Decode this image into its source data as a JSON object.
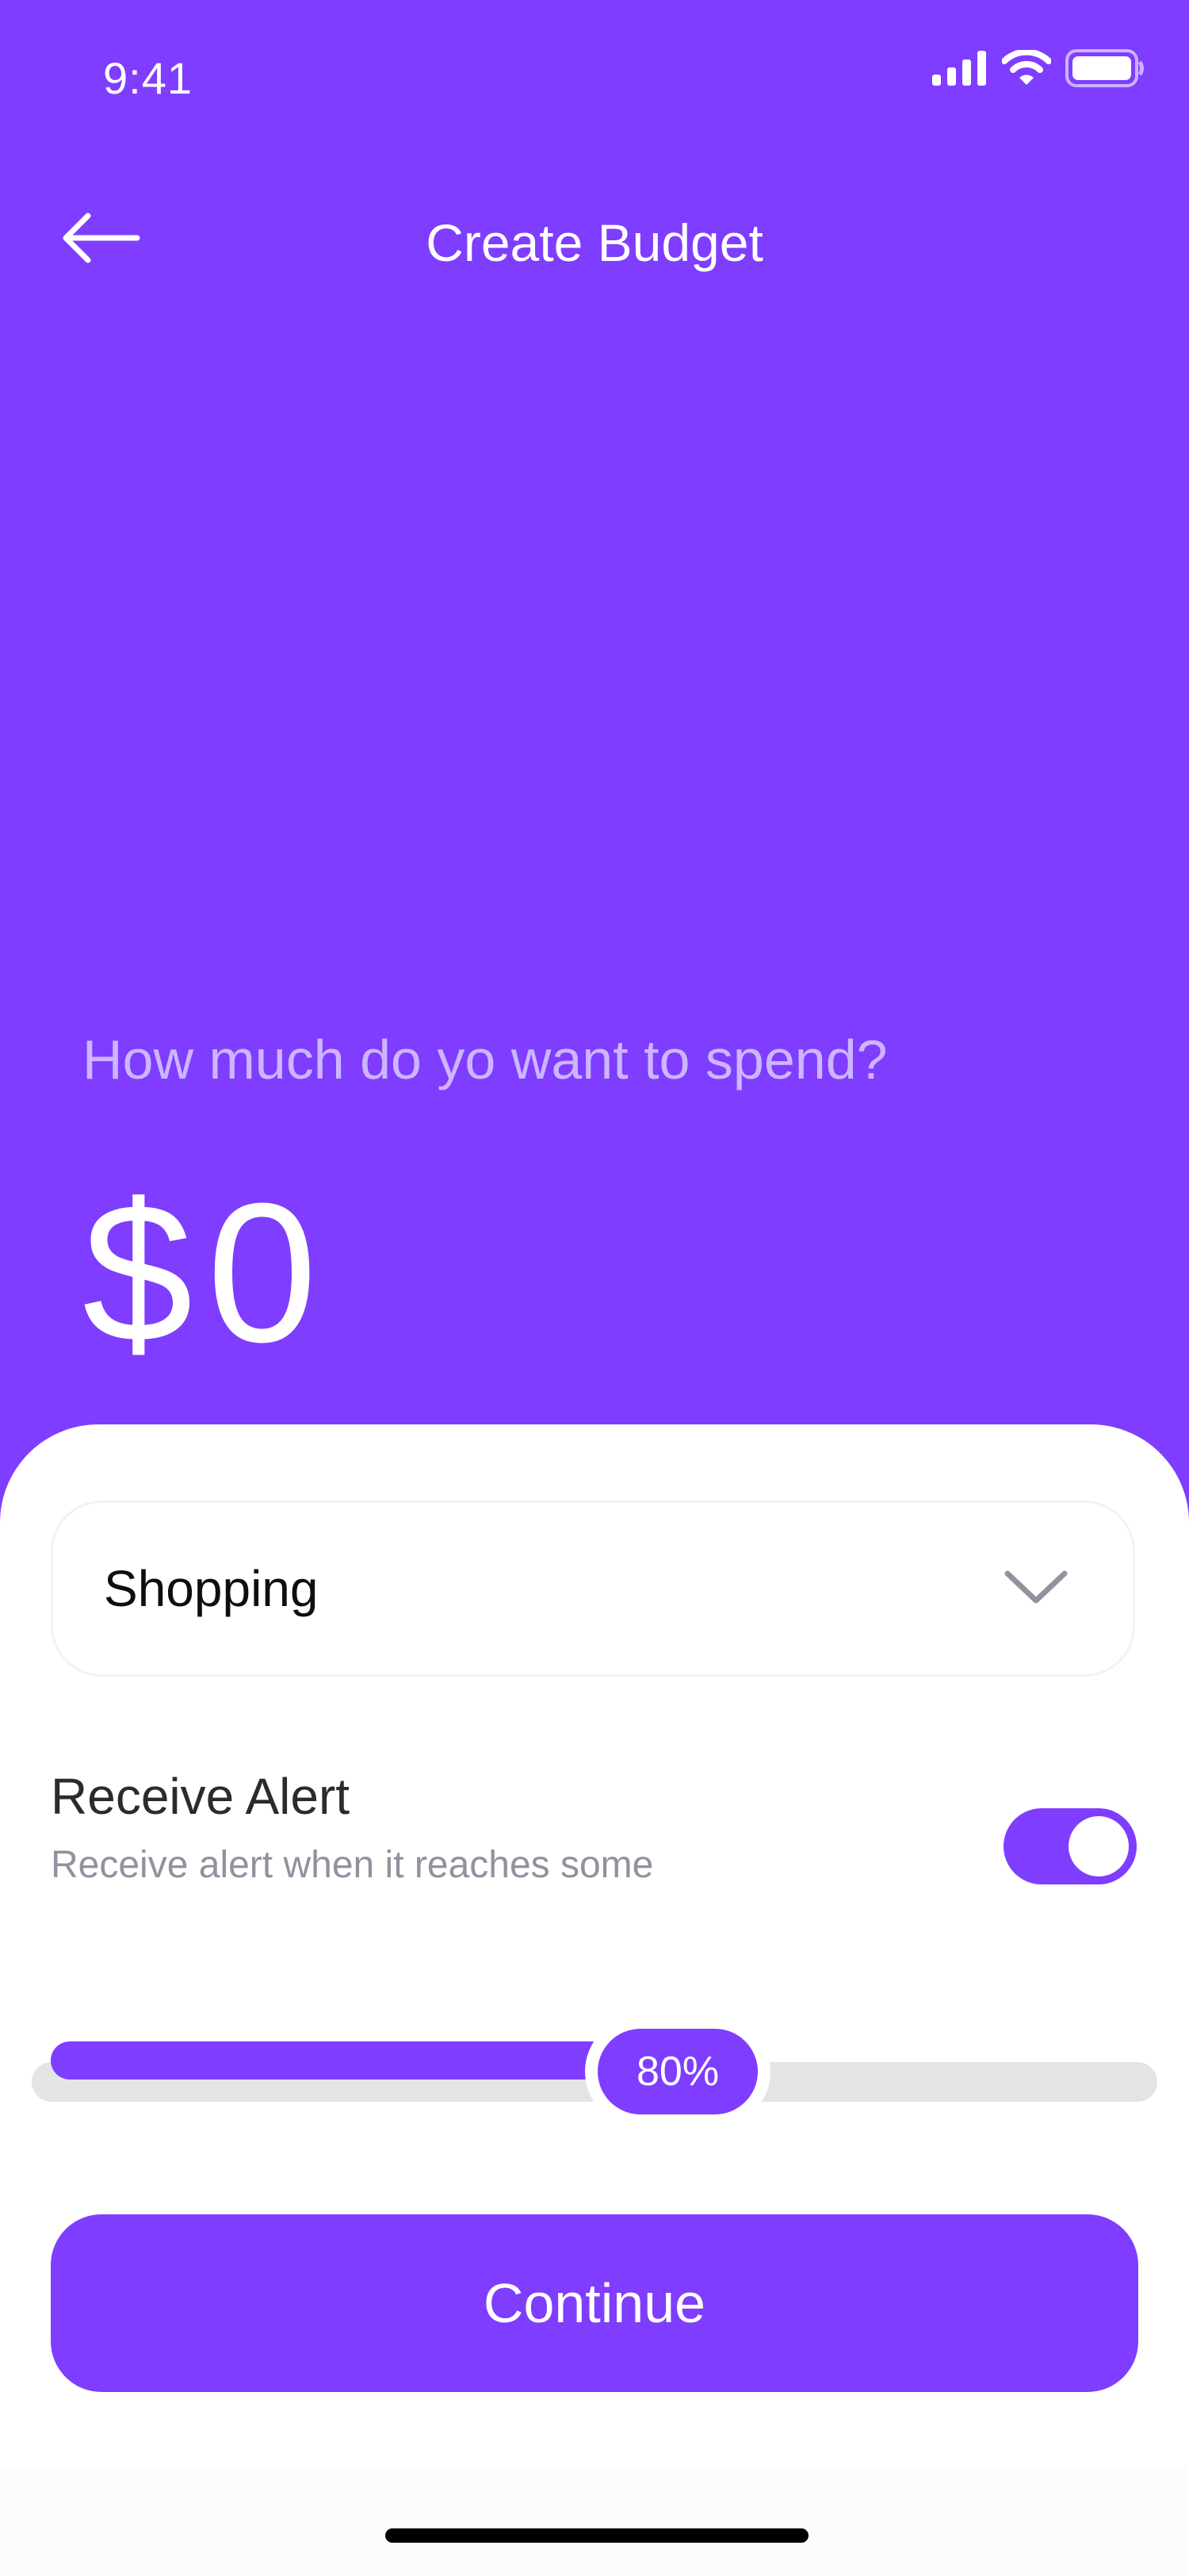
{
  "status_bar": {
    "time": "9:41",
    "signal_icon": "cellular-signal-icon",
    "wifi_icon": "wifi-icon",
    "battery_icon": "battery-icon"
  },
  "header": {
    "back_icon": "arrow-left-icon",
    "title": "Create Budget"
  },
  "amount": {
    "question": "How much do yo want to spend?",
    "value": "$0"
  },
  "form": {
    "category": {
      "selected": "Shopping",
      "icon": "chevron-down-icon"
    },
    "alert": {
      "title": "Receive Alert",
      "subtitle": "Receive alert when it reaches some",
      "enabled": true
    },
    "alert_threshold": {
      "value": 0.8,
      "label": "80%"
    },
    "continue_label": "Continue"
  },
  "colors": {
    "primary": "#7F3DFF",
    "background_sheet": "#FFFFFF",
    "track": "#E3E5E5",
    "subtitle": "#91919F"
  }
}
